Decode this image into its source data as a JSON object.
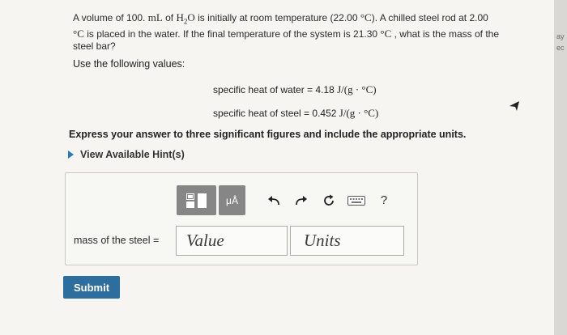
{
  "problem": {
    "line1_a": "A volume of 100. ",
    "line1_unit": "mL",
    "line1_b": " of ",
    "line1_h2o": "H",
    "line1_sub2": "2",
    "line1_o": "O",
    "line1_c": " is initially at room temperature (22.00 ",
    "line1_deg": "°C",
    "line1_d": "). A chilled steel rod at 2.00",
    "line2_deg": "°C",
    "line2_a": " is placed in the water. If the final temperature of the system is 21.30 ",
    "line2_deg2": "°C",
    "line2_b": " , what is the mass of the",
    "line3": "steel bar?"
  },
  "use_values": "Use the following values:",
  "heat_water": {
    "prefix": "specific heat of water = 4.18 ",
    "unit": "J/(g · °C)"
  },
  "heat_steel": {
    "prefix": "specific heat of steel = 0.452 ",
    "unit": "J/(g · °C)"
  },
  "instruction": "Express your answer to three significant figures and include the appropriate units.",
  "hint_label": "View Available Hint(s)",
  "toolbar": {
    "mu_a": "μÅ",
    "help": "?"
  },
  "answer": {
    "label": "mass of the steel =",
    "value_placeholder": "Value",
    "units_placeholder": "Units"
  },
  "submit_label": "Submit",
  "edge_fragments": [
    "ay",
    "ec"
  ],
  "colors": {
    "submit_bg": "#2d6e9e",
    "hint_arrow": "#2a7ab8",
    "toolbar_grey": "#868686"
  }
}
